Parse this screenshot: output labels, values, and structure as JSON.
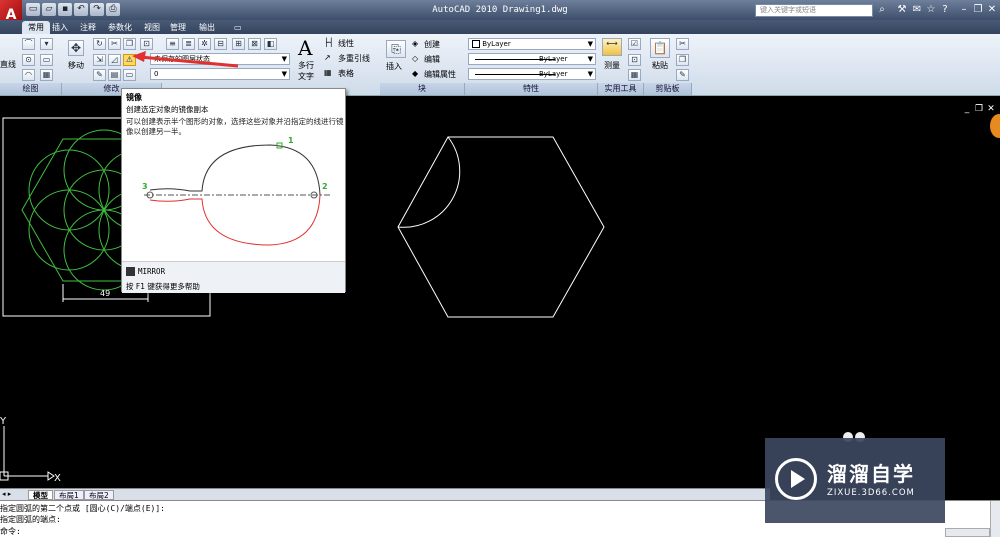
{
  "title_bar": {
    "app_logo": "A",
    "title": "AutoCAD 2010   Drawing1.dwg",
    "search_placeholder": "键入关键字或短语",
    "quick_access": [
      "new-icon",
      "open-icon",
      "save-icon",
      "undo-icon",
      "redo-icon",
      "print-icon"
    ]
  },
  "ribbon_tabs": [
    "常用",
    "插入",
    "注释",
    "参数化",
    "视图",
    "管理",
    "输出"
  ],
  "active_tab": "常用",
  "ribbon": {
    "draw": {
      "line_label": "直线",
      "panel": "绘图"
    },
    "modify": {
      "move_label": "移动",
      "panel": "修改"
    },
    "layers": {
      "state_label": "未保存的图层状态",
      "layer_value": "0"
    },
    "annotation": {
      "text_label": "多行文字",
      "linear": "线性",
      "multileader": "多重引线",
      "table": "表格"
    },
    "block": {
      "insert_label": "插入",
      "create": "创建",
      "edit": "编辑",
      "edit_attr": "编辑属性",
      "panel": "块"
    },
    "properties": {
      "color": "ByLayer",
      "linetype": "ByLayer",
      "lineweight": "ByLayer",
      "panel": "特性"
    },
    "utilities": {
      "measure": "测量",
      "panel": "实用工具"
    },
    "clipboard": {
      "paste": "粘贴",
      "panel": "剪贴板"
    }
  },
  "tooltip": {
    "title": "镜像",
    "subtitle": "创建选定对象的镜像副本",
    "description": "可以创建表示半个图形的对象，选择这些对象并沿指定的线进行镜像以创建另一半。",
    "point_labels": [
      "1",
      "2",
      "3"
    ],
    "command": "MIRROR",
    "help": "按 F1 键获得更多帮助"
  },
  "drawing": {
    "dimension": "49",
    "ucs_x": "X",
    "ucs_y": "Y"
  },
  "layout_tabs": [
    "模型",
    "布局1",
    "布局2"
  ],
  "active_layout": "模型",
  "command_lines": [
    "指定圆弧的第二个点或 [圆心(C)/端点(E)]:",
    "指定圆弧的端点:",
    "命令:"
  ],
  "watermark": {
    "title": "溜溜自学",
    "url": "ZIXUE.3D66.COM"
  },
  "colors": {
    "accent": "#ffd86b",
    "green_lines": "#3fbf3f",
    "mirror_red": "#e03030"
  }
}
